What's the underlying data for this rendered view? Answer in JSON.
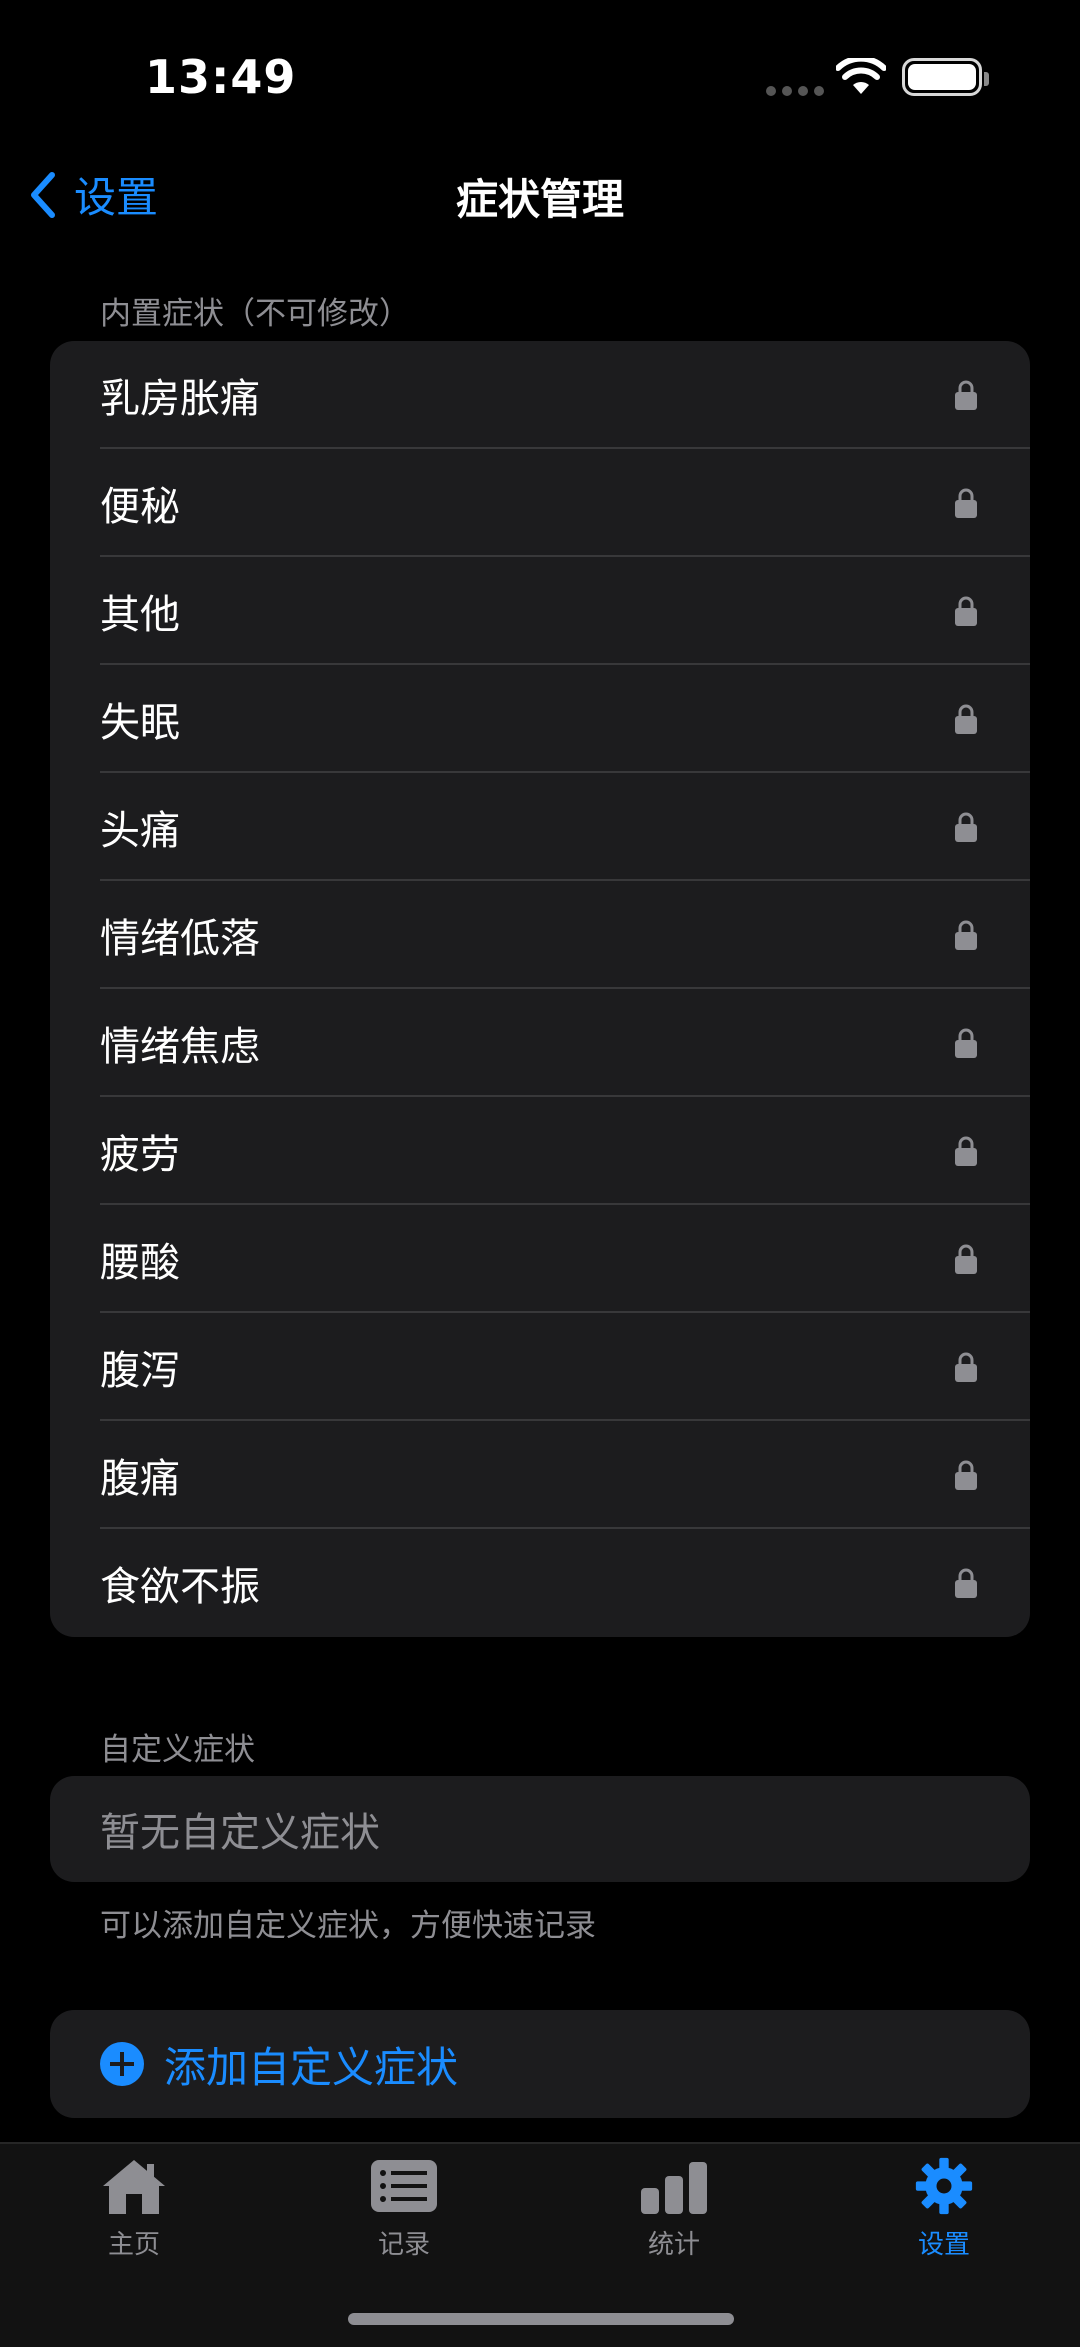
{
  "status": {
    "time": "13:49"
  },
  "nav": {
    "back_label": "设置",
    "title": "症状管理"
  },
  "builtin": {
    "header": "内置症状（不可修改）",
    "items": [
      {
        "label": "乳房胀痛"
      },
      {
        "label": "便秘"
      },
      {
        "label": "其他"
      },
      {
        "label": "失眠"
      },
      {
        "label": "头痛"
      },
      {
        "label": "情绪低落"
      },
      {
        "label": "情绪焦虑"
      },
      {
        "label": "疲劳"
      },
      {
        "label": "腰酸"
      },
      {
        "label": "腹泻"
      },
      {
        "label": "腹痛"
      },
      {
        "label": "食欲不振"
      }
    ]
  },
  "custom": {
    "header": "自定义症状",
    "empty_text": "暂无自定义症状",
    "footer": "可以添加自定义症状，方便快速记录",
    "add_label": "添加自定义症状"
  },
  "tabbar": {
    "items": [
      {
        "label": "主页",
        "icon": "house-icon"
      },
      {
        "label": "记录",
        "icon": "list-icon"
      },
      {
        "label": "统计",
        "icon": "bar-chart-icon"
      },
      {
        "label": "设置",
        "icon": "gear-icon",
        "active": true
      }
    ]
  },
  "colors": {
    "accent": "#1a8cff",
    "background": "#000000",
    "card": "#1c1c1e",
    "secondary_text": "#8e8e93"
  }
}
